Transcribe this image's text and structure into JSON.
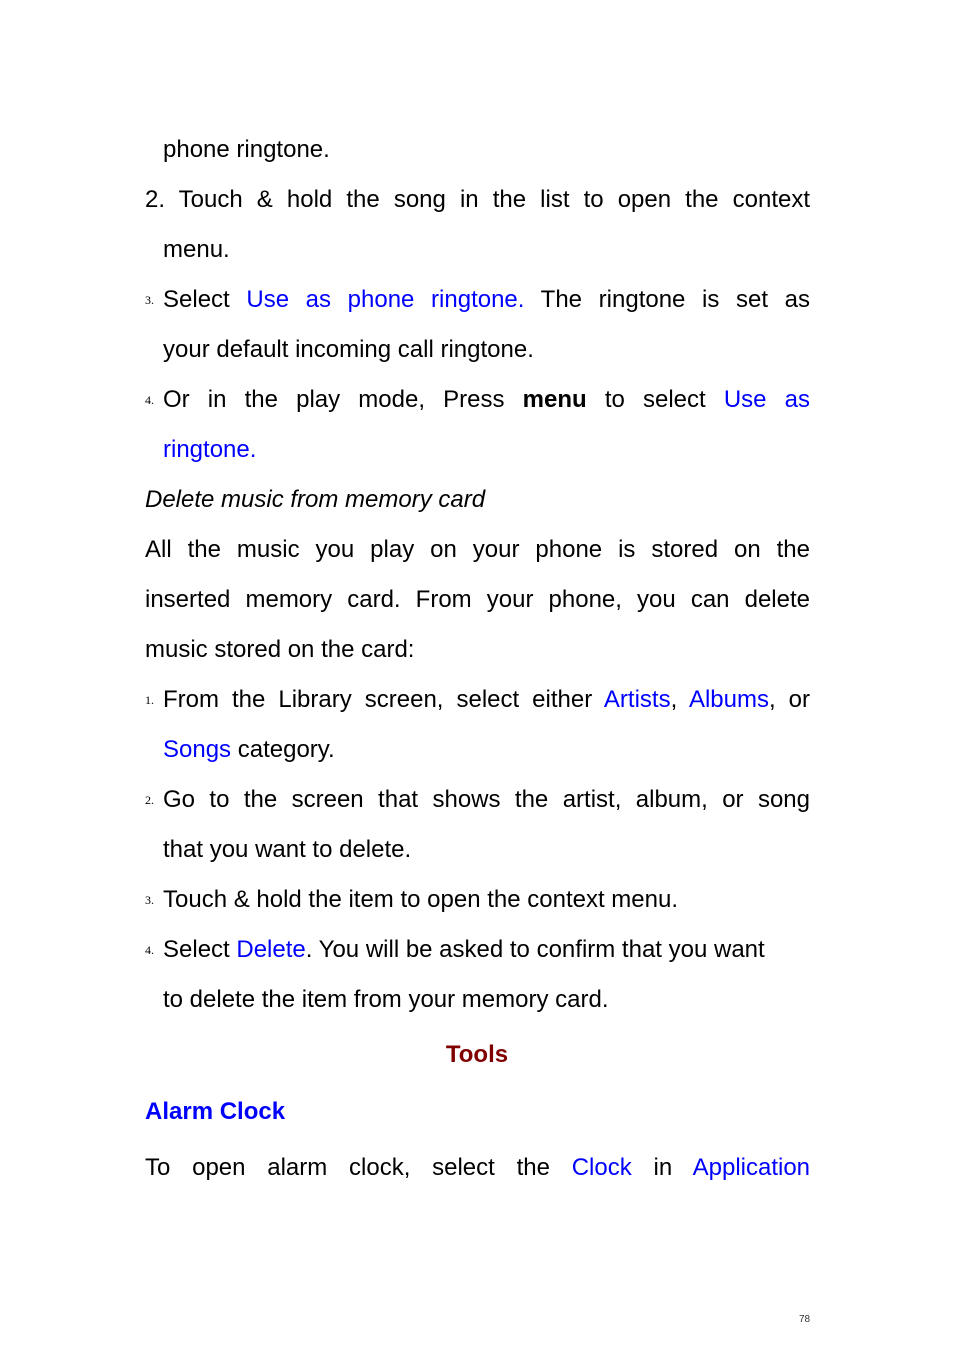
{
  "page_number": "78",
  "colors": {
    "link": "#0000ff",
    "section_heading": "#800000",
    "body": "#000000"
  },
  "continuation": "phone ringtone.",
  "set_ringtone_steps": [
    {
      "num": "2.",
      "line1": "Touch & hold the song in the list to open the context",
      "line2": "menu."
    },
    {
      "num": "3.",
      "pre": "Select",
      "link": "Use as phone ringtone.",
      "post": "The ringtone is set as",
      "line2": "your default incoming call ringtone."
    },
    {
      "num": "4.",
      "pre": "Or in the play mode, Press",
      "bold": "menu",
      "mid": "to select",
      "link": "Use as",
      "line2_link": "ringtone."
    }
  ],
  "delete_section": {
    "title": "Delete music from memory card",
    "intro_line1": "All the music you play on your phone is stored on the",
    "intro_line2": "inserted memory card. From your phone, you can delete",
    "intro_line3": "music stored on the card:",
    "steps": [
      {
        "num": "1.",
        "pre": "From the Library screen, select either",
        "link1": "Artists",
        "sep": ",",
        "link2": "Albums",
        "post": ", or",
        "line2_link": "Songs",
        "line2_post": "category."
      },
      {
        "num": "2.",
        "line1": "Go to the screen that shows the artist, album, or song",
        "line2": "that you want to delete."
      },
      {
        "num": "3.",
        "line1": "Touch & hold the item to open the context menu."
      },
      {
        "num": "4.",
        "pre": "Select",
        "link": "Delete",
        "post": ". You will be asked to confirm that you want",
        "line2": "to delete the item from your memory card."
      }
    ]
  },
  "tools_heading": "Tools",
  "alarm_heading": "Alarm Clock",
  "alarm_text": {
    "pre": "To open alarm clock, select the",
    "link1": "Clock",
    "mid": "in",
    "link2": "Application"
  }
}
